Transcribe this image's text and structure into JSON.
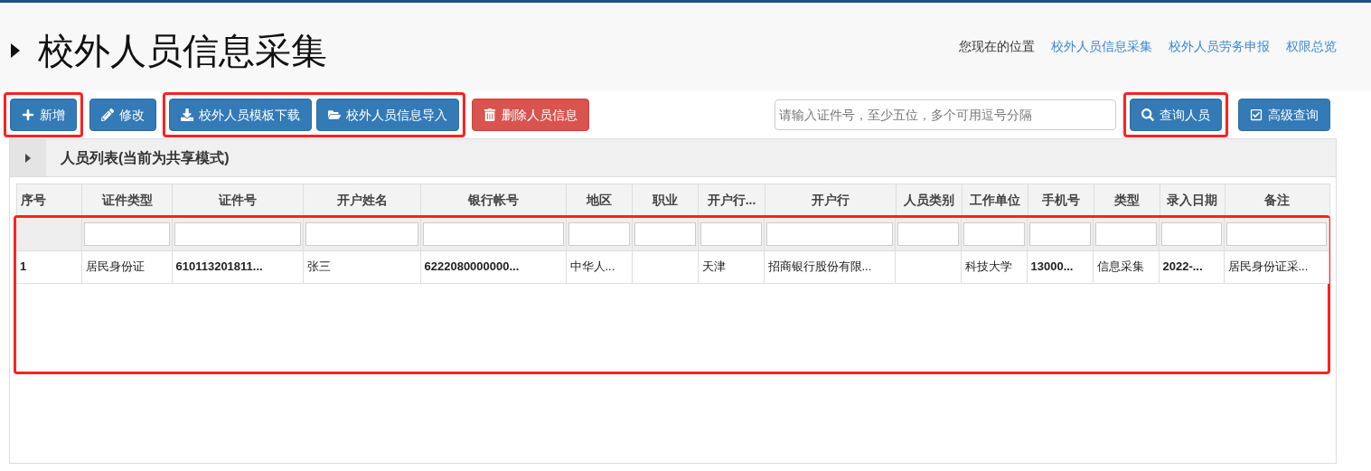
{
  "page_title": "校外人员信息采集",
  "breadcrumb": [
    {
      "text": "您现在的位置",
      "link": false
    },
    {
      "text": "校外人员信息采集",
      "link": true
    },
    {
      "text": "校外人员劳务申报",
      "link": true
    },
    {
      "text": "权限总览",
      "link": true
    }
  ],
  "toolbar_groups": [
    {
      "highlighted": true,
      "buttons": [
        {
          "label": "新增",
          "kind": "primary"
        }
      ]
    },
    {
      "highlighted": false,
      "buttons": [
        {
          "label": "修改",
          "kind": "primary"
        }
      ]
    },
    {
      "highlighted": true,
      "buttons": [
        {
          "label": "校外人员模板下载",
          "kind": "primary"
        },
        {
          "label": "校外人员信息导入",
          "kind": "primary"
        }
      ]
    },
    {
      "highlighted": false,
      "buttons": [
        {
          "label": "删除人员信息",
          "kind": "danger"
        }
      ]
    }
  ],
  "search": {
    "placeholder": "请输入证件号，至少五位，多个可用逗号分隔"
  },
  "search_groups": [
    {
      "highlighted": true,
      "buttons": [
        {
          "label": "查询人员",
          "kind": "primary"
        }
      ]
    },
    {
      "highlighted": false,
      "buttons": [
        {
          "label": "高级查询",
          "kind": "primary"
        }
      ]
    }
  ],
  "panel": {
    "title": "人员列表(当前为共享模式)",
    "expanded": false
  },
  "table": {
    "highlighted": true,
    "columns": [
      {
        "label": "序号",
        "filter": false
      },
      {
        "label": "证件类型",
        "filter": true
      },
      {
        "label": "证件号",
        "filter": true
      },
      {
        "label": "开户姓名",
        "filter": true
      },
      {
        "label": "银行帐号",
        "filter": true
      },
      {
        "label": "地区",
        "filter": true
      },
      {
        "label": "职业",
        "filter": true
      },
      {
        "label": "开户行...",
        "filter": true
      },
      {
        "label": "开户行",
        "filter": true
      },
      {
        "label": "人员类别",
        "filter": true
      },
      {
        "label": "工作单位",
        "filter": true
      },
      {
        "label": "手机号",
        "filter": true
      },
      {
        "label": "类型",
        "filter": true
      },
      {
        "label": "录入日期",
        "filter": true
      },
      {
        "label": "备注",
        "filter": true
      }
    ],
    "rows": [
      {
        "cells": [
          {
            "text": "1",
            "bold": true
          },
          {
            "text": "居民身份证",
            "bold": false
          },
          {
            "text": "610113201811...",
            "bold": true
          },
          {
            "text": "张三",
            "bold": false
          },
          {
            "text": "6222080000000...",
            "bold": true
          },
          {
            "text": "中华人...",
            "bold": false
          },
          null,
          {
            "text": "天津",
            "bold": false
          },
          {
            "text": "招商银行股份有限...",
            "bold": false
          },
          null,
          {
            "text": "科技大学",
            "bold": false
          },
          {
            "text": "13000...",
            "bold": true
          },
          {
            "text": "信息采集",
            "bold": false
          },
          {
            "text": "2022-...",
            "bold": true
          },
          {
            "text": "居民身份证采...",
            "bold": false
          }
        ]
      }
    ]
  }
}
